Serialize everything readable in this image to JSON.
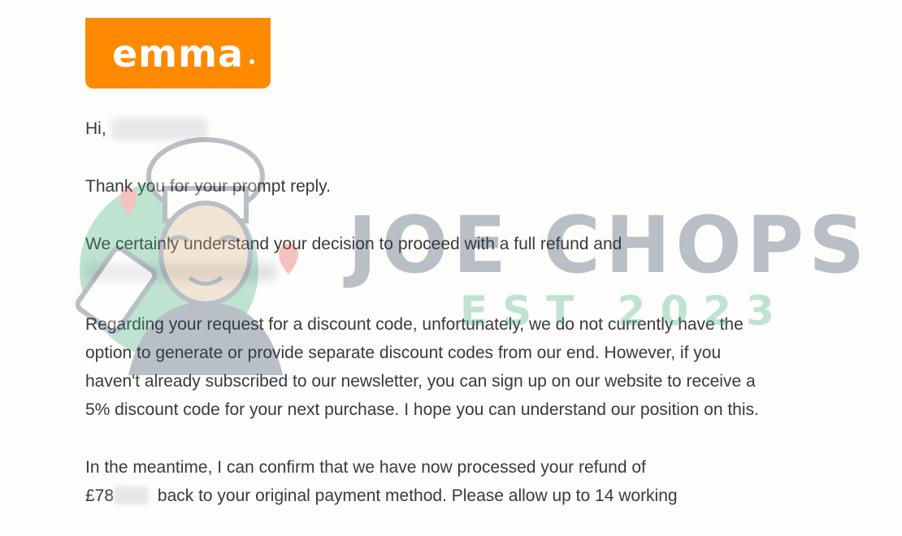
{
  "email": {
    "logo_text": "emma",
    "greeting": "Hi,",
    "paragraphs": {
      "p1": "Thank you for your prompt reply.",
      "p2": "We certainly understand your decision to proceed with a full refund and",
      "p3": "Regarding your request for a discount code, unfortunately, we do not currently have the option to generate or provide separate discount codes from our end. However, if you haven't already subscribed to our newsletter, you can sign up on our website to receive a 5% discount code for your next purchase. I hope you can understand our position on this.",
      "p4_start": "In the meantime, I can confirm that we have now processed your refund of",
      "p4_amount_prefix": "£78",
      "p4_end": "back to your original payment method. Please allow up to 14 working"
    }
  },
  "watermark": {
    "title": "JOE CHOPS",
    "subtitle": "EST 2023"
  },
  "colors": {
    "brand_orange": "#ff8a00",
    "watermark_navy": "#2a3f5a",
    "watermark_green": "#3fae7a"
  }
}
